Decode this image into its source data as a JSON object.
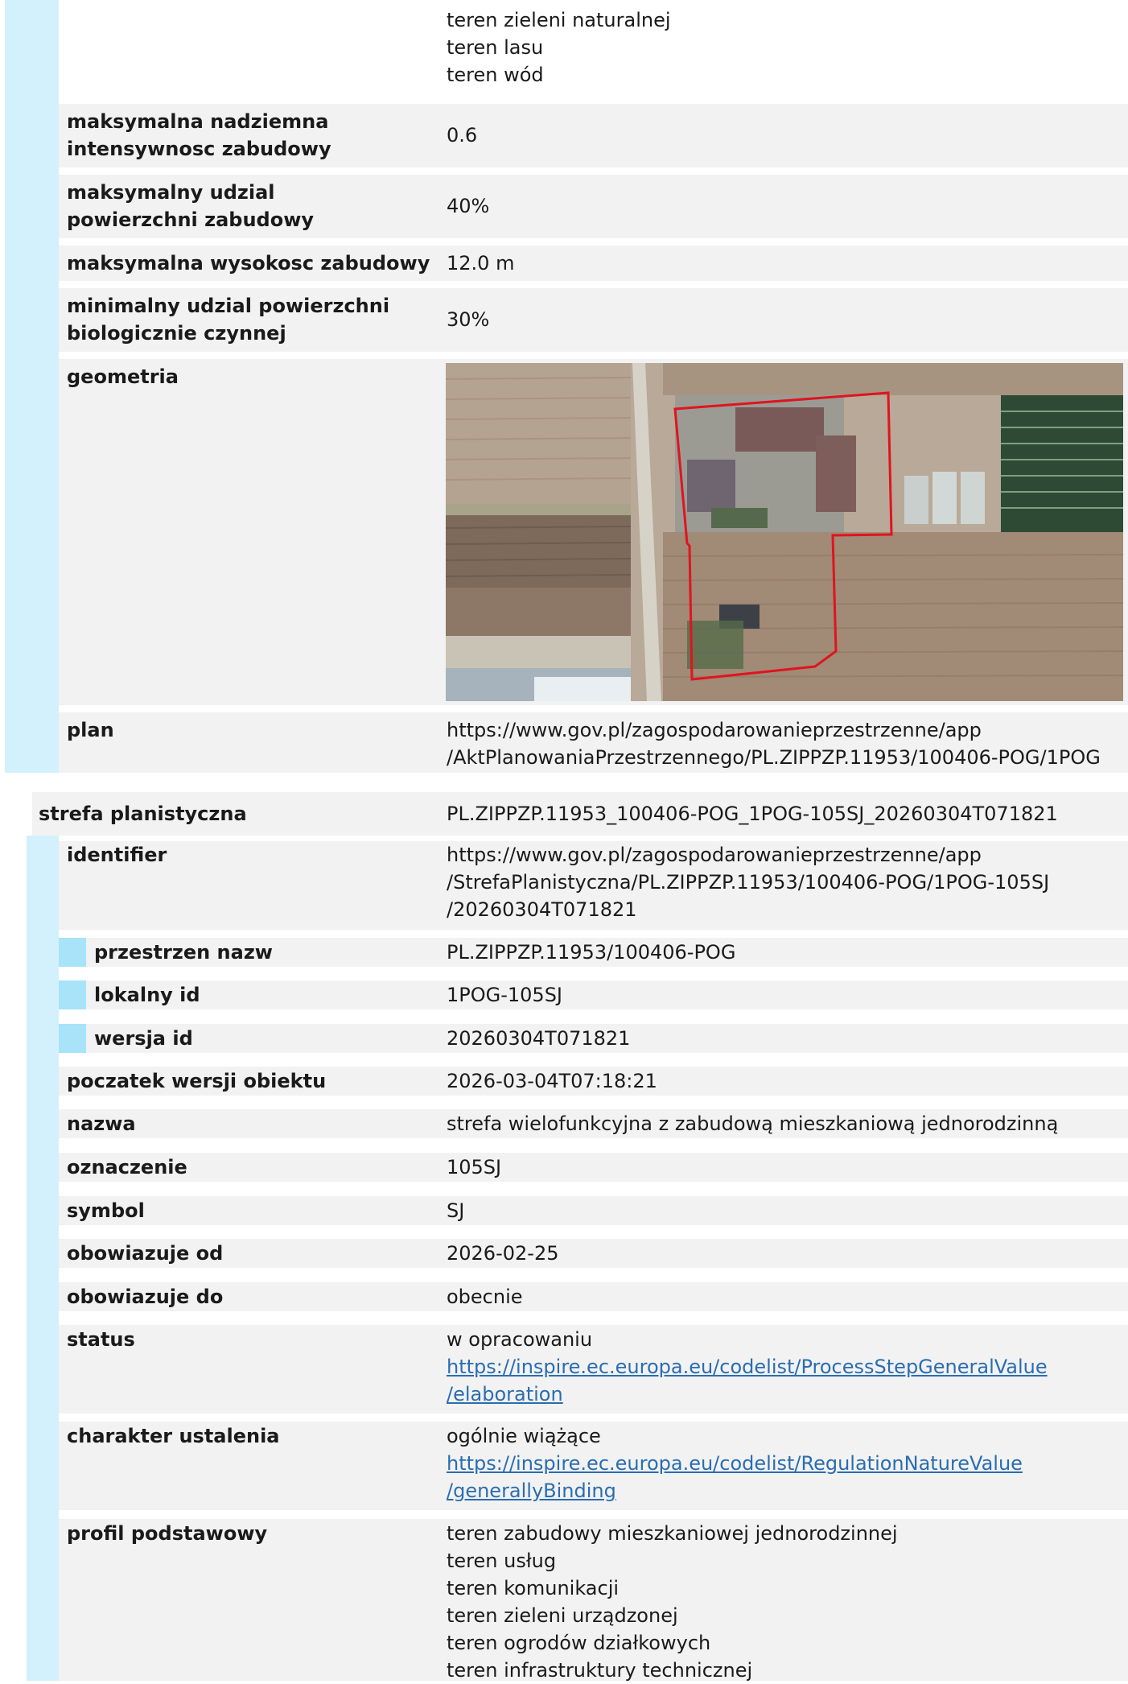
{
  "top_block": {
    "landuse_tail": [
      "teren zieleni naturalnej",
      "teren lasu",
      "teren wód"
    ],
    "intensity": {
      "label": "maksymalna nadziemna intensywnosc zabudowy",
      "value": "0.6"
    },
    "built_share": {
      "label": "maksymalny udzial powierzchni zabudowy",
      "value": "40%"
    },
    "max_height": {
      "label": "maksymalna wysokosc zabudowy",
      "value": "12.0 m"
    },
    "bio_share": {
      "label": "minimalny udzial powierzchni biologicznie czynnej",
      "value": "30%"
    },
    "geometry_label": "geometria",
    "plan": {
      "label": "plan",
      "value_lines": [
        "https://www.gov.pl/zagospodarowanieprzestrzenne/app",
        "/AktPlanowaniaPrzestrzennego/PL.ZIPPZP.11953/100406-POG/1POG"
      ]
    }
  },
  "zone": {
    "label": "strefa planistyczna",
    "value": "PL.ZIPPZP.11953_100406-POG_1POG-105SJ_20260304T071821",
    "identifier": {
      "label": "identifier",
      "value_lines": [
        "https://www.gov.pl/zagospodarowanieprzestrzenne/app",
        "/StrefaPlanistyczna/PL.ZIPPZP.11953/100406-POG/1POG-105SJ",
        "/20260304T071821"
      ],
      "namespace": {
        "label": "przestrzen nazw",
        "value": "PL.ZIPPZP.11953/100406-POG"
      },
      "local_id": {
        "label": "lokalny id",
        "value": "1POG-105SJ"
      },
      "version_id": {
        "label": "wersja id",
        "value": "20260304T071821"
      }
    },
    "version_start": {
      "label": "poczatek wersji obiektu",
      "value": "2026-03-04T07:18:21"
    },
    "name": {
      "label": "nazwa",
      "value": "strefa wielofunkcyjna z zabudową mieszkaniową jednorodzinną"
    },
    "designation": {
      "label": "oznaczenie",
      "value": "105SJ"
    },
    "symbol": {
      "label": "symbol",
      "value": "SJ"
    },
    "valid_from": {
      "label": "obowiazuje od",
      "value": "2026-02-25"
    },
    "valid_to": {
      "label": "obowiazuje do",
      "value": "obecnie"
    },
    "status": {
      "label": "status",
      "text": "w opracowaniu",
      "link_lines": [
        "https://inspire.ec.europa.eu/codelist/ProcessStepGeneralValue",
        "/elaboration"
      ]
    },
    "regulation": {
      "label": "charakter ustalenia",
      "text": "ogólnie wiążące",
      "link_lines": [
        "https://inspire.ec.europa.eu/codelist/RegulationNatureValue",
        "/generallyBinding"
      ]
    },
    "profile": {
      "label": "profil podstawowy",
      "items": [
        "teren zabudowy mieszkaniowej jednorodzinnej",
        "teren usług",
        "teren komunikacji",
        "teren zieleni urządzonej",
        "teren ogrodów działkowych",
        "teren infrastruktury technicznej"
      ]
    }
  },
  "colors": {
    "row_bg": "#f2f2f2",
    "bar_light": "#d2f1fc",
    "bar_accent": "#a8e3fa",
    "link": "#2a6db0",
    "boundary": "#e0141e"
  }
}
